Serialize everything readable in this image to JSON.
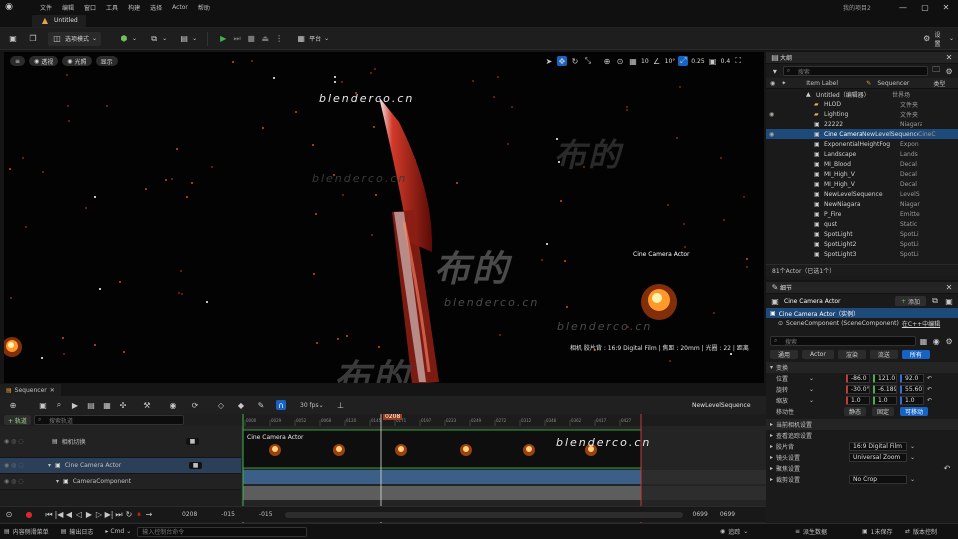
{
  "menu": [
    "文件",
    "编辑",
    "窗口",
    "工具",
    "构建",
    "选择",
    "Actor",
    "帮助"
  ],
  "project_name": "我的项目2",
  "tab": {
    "label": "Untitled"
  },
  "toolbar": {
    "mode_label": "选项模式",
    "platform_label": "平台",
    "settings_label": "设置"
  },
  "viewport": {
    "pill_perspective": "透视",
    "pill_lit": "光照",
    "pill_show": "显示",
    "grid_value": "10",
    "angle_value": "10°",
    "scale_value": "0.25",
    "speed_value": "0.4",
    "actor_label": "Cine Camera Actor",
    "camera_info": "相机 胶片背 : 16:9 Digital Film | 焦距 : 20mm | 光圈 : 22 | 距离",
    "watermark_text": "blenderco.cn",
    "watermark_cn": "布的"
  },
  "outliner": {
    "title": "大纲",
    "search_placeholder": "搜索",
    "col_label": "Item Label",
    "col_sequencer": "Sequencer",
    "col_type": "类型",
    "footer": "81个Actor（已选1个）",
    "rows": [
      {
        "label": "Untitled（编辑器）",
        "type": "世界场"
      },
      {
        "label": "HLOD",
        "type": "文件夹"
      },
      {
        "label": "Lighting",
        "type": "文件夹"
      },
      {
        "label": "22222",
        "type": "Niagara"
      },
      {
        "label": "Cine Camera Actor",
        "seq": "NewLevelSequence",
        "type": "CineC"
      },
      {
        "label": "ExponentialHeightFog",
        "type": "Expon"
      },
      {
        "label": "Landscape",
        "type": "Lands"
      },
      {
        "label": "MI_Blood",
        "type": "Decal"
      },
      {
        "label": "MI_High_V",
        "type": "Decal"
      },
      {
        "label": "MI_High_V",
        "type": "Decal"
      },
      {
        "label": "NewLevelSequence",
        "type": "LevelS"
      },
      {
        "label": "NewNiagara",
        "type": "Niagar"
      },
      {
        "label": "P_Fire",
        "type": "Emitte"
      },
      {
        "label": "qust",
        "type": "Static"
      },
      {
        "label": "SpotLight",
        "type": "SpotLi"
      },
      {
        "label": "SpotLight2",
        "type": "SpotLi"
      },
      {
        "label": "SpotLight3",
        "type": "SpotLi"
      }
    ]
  },
  "details": {
    "title": "细节",
    "actor_name": "Cine Camera Actor",
    "add_label": "添加",
    "comp_root": "Cine Camera Actor（实例）",
    "comp_scene": "SceneComponent (SceneComponent)",
    "comp_scene_link": "在C++中编辑",
    "search_placeholder": "搜索",
    "tabs": [
      "通用",
      "Actor",
      "渲染",
      "流送",
      "所有"
    ],
    "section_transform": "变换",
    "rows": [
      {
        "label": "位置",
        "values": [
          "-86.0",
          "121.0",
          "92.0"
        ]
      },
      {
        "label": "旋转",
        "values": [
          "-30.0°",
          "-6.189°",
          "55.601°"
        ]
      },
      {
        "label": "缩放",
        "values": [
          "1.0",
          "1.0",
          "1.0"
        ]
      }
    ],
    "mobility_label": "移动性",
    "mobility_options": [
      "静态",
      "固定",
      "可移动"
    ],
    "section_current": "当前相机设置",
    "section_lookat": "查看追踪设置",
    "filmback_label": "胶片背",
    "filmback_value": "16:9 Digital Film",
    "lens_label": "镜头设置",
    "lens_value": "Universal Zoom",
    "focus_label": "聚焦设置",
    "crop_label": "裁剪设置",
    "crop_value": "No Crop"
  },
  "sequencer": {
    "tab_label": "Sequencer",
    "add_label": "+ 轨道",
    "search_placeholder": "搜索轨道",
    "fps_label": "30 fps",
    "sequence_name": "NewLevelSequence",
    "playhead_frame": "0208",
    "tracks": [
      {
        "label": "相机切换",
        "type": "camera-cut"
      },
      {
        "label": "Cine Camera Actor",
        "type": "actor"
      },
      {
        "label": "CameraComponent",
        "type": "component"
      }
    ],
    "clip_label": "Cine Camera Actor",
    "ruler_labels": [
      "0000",
      "0029",
      "0052",
      "0068",
      "0120",
      "0145",
      "0171",
      "0197",
      "0223",
      "0249",
      "0272",
      "0312",
      "0348",
      "0362",
      "0417",
      "0427"
    ],
    "range_left": "-015",
    "range_left2": "-015",
    "range_right": "0699",
    "range_right2": "0699",
    "current_frame": "0208"
  },
  "status": {
    "content_drawer": "内容侧滑菜单",
    "output_log": "输出日志",
    "cmd": "Cmd",
    "console_placeholder": "输入控制台命令",
    "trace": "追踪",
    "derived": "派生数据",
    "unsaved": "1未保存",
    "source_control": "版本控制"
  },
  "colors": {
    "accent": "#1763c3",
    "selection": "#1e4a7a",
    "play_green": "#3fb34f",
    "ember": "#d64a1a"
  }
}
